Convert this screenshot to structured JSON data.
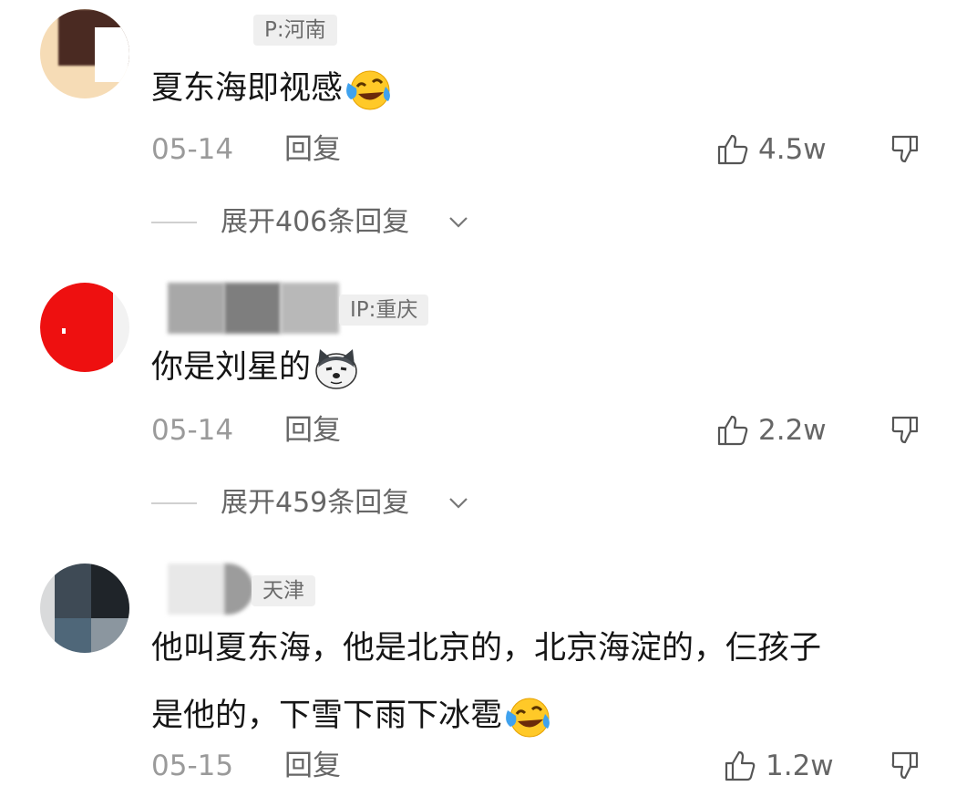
{
  "comments": [
    {
      "ip": "P:河南",
      "text": "夏东海即视感",
      "emoji": "laughing-crying-emoji",
      "date": "05-14",
      "reply_label": "回复",
      "likes": "4.5w",
      "expand_label": "展开406条回复"
    },
    {
      "ip": "IP:重庆",
      "text": "你是刘星的",
      "emoji": "dog-face-emoji",
      "date": "05-14",
      "reply_label": "回复",
      "likes": "2.2w",
      "expand_label": "展开459条回复"
    },
    {
      "ip": "天津",
      "text_line1": "他叫夏东海，他是北京的，北京海淀的，仨孩子",
      "text_line2": "是他的，下雪下雨下冰雹",
      "emoji": "laughing-crying-emoji",
      "date": "05-15",
      "reply_label": "回复",
      "likes": "1.2w"
    }
  ],
  "icons": {
    "like": "thumbs-up-icon",
    "dislike": "thumbs-down-icon",
    "expand": "chevron-down-icon"
  },
  "colors": {
    "text": "#161616",
    "meta": "#9a9a9a",
    "secondary": "#666666",
    "tag_bg": "#efefef"
  }
}
